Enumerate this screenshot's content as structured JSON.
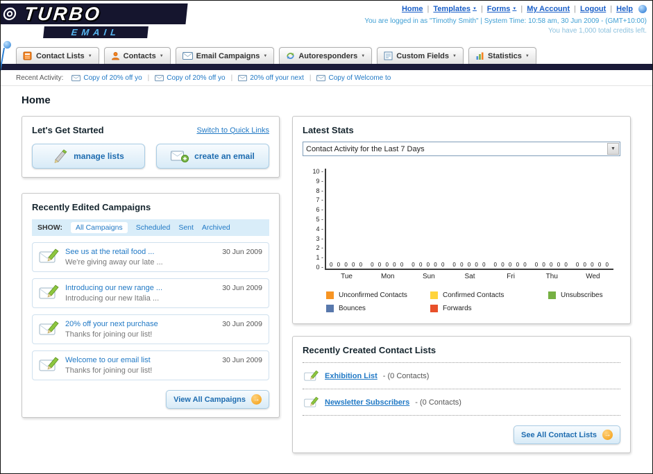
{
  "header": {
    "logo_top": "TURBO",
    "logo_bottom": "EMAIL",
    "nav_links": [
      {
        "label": "Home"
      },
      {
        "label": "Templates"
      },
      {
        "label": "Forms"
      },
      {
        "label": "My Account"
      },
      {
        "label": "Logout"
      },
      {
        "label": "Help"
      }
    ],
    "login_info": "You are logged in as \"Timothy Smith\" | System Time: 10:58 am, 30 Jun 2009 - (GMT+10:00)",
    "credits_info": "You have 1,000 total credits left."
  },
  "nav_tabs": [
    {
      "label": "Contact Lists"
    },
    {
      "label": "Contacts"
    },
    {
      "label": "Email Campaigns"
    },
    {
      "label": "Autoresponders"
    },
    {
      "label": "Custom Fields"
    },
    {
      "label": "Statistics"
    }
  ],
  "recent_activity": {
    "label": "Recent Activity:",
    "items": [
      "Copy of 20% off yo",
      "Copy of 20% off yo",
      "20% off your next",
      "Copy of Welcome to"
    ]
  },
  "page_title": "Home",
  "get_started": {
    "title": "Let's Get Started",
    "switch_link": "Switch to Quick Links",
    "manage_lists_label": "manage lists",
    "create_email_label": "create an email"
  },
  "campaigns": {
    "title": "Recently Edited Campaigns",
    "show_label": "SHOW:",
    "tabs": [
      "All Campaigns",
      "Scheduled",
      "Sent",
      "Archived"
    ],
    "active_tab": "All Campaigns",
    "items": [
      {
        "title": "See us at the retail food ...",
        "subtitle": "We're giving away our late ...",
        "date": "30 Jun 2009"
      },
      {
        "title": "Introducing our new range ...",
        "subtitle": "Introducing our new Italia ...",
        "date": "30 Jun 2009"
      },
      {
        "title": "20% off your next purchase",
        "subtitle": "Thanks for joining our list!",
        "date": "30 Jun 2009"
      },
      {
        "title": "Welcome to our email list",
        "subtitle": "Thanks for joining our list!",
        "date": "30 Jun 2009"
      }
    ],
    "view_all_label": "View All Campaigns"
  },
  "stats": {
    "title": "Latest Stats",
    "selector_value": "Contact Activity for the Last 7 Days",
    "chart_data": {
      "type": "bar",
      "title": "Contact Activity for the Last 7 Days",
      "categories": [
        "Tue",
        "Mon",
        "Sun",
        "Sat",
        "Fri",
        "Thu",
        "Wed"
      ],
      "series": [
        {
          "name": "Unconfirmed Contacts",
          "color": "#f79423",
          "values": [
            0,
            0,
            0,
            0,
            0,
            0,
            0
          ]
        },
        {
          "name": "Confirmed Contacts",
          "color": "#ffd43c",
          "values": [
            0,
            0,
            0,
            0,
            0,
            0,
            0
          ]
        },
        {
          "name": "Unsubscribes",
          "color": "#76b043",
          "values": [
            0,
            0,
            0,
            0,
            0,
            0,
            0
          ]
        },
        {
          "name": "Bounces",
          "color": "#5878ac",
          "values": [
            0,
            0,
            0,
            0,
            0,
            0,
            0
          ]
        },
        {
          "name": "Forwards",
          "color": "#e8502a",
          "values": [
            0,
            0,
            0,
            0,
            0,
            0,
            0
          ]
        }
      ],
      "ylim": [
        0,
        10
      ],
      "ytick_step": 1,
      "grid": false,
      "legend_position": "bottom"
    }
  },
  "contact_lists": {
    "title": "Recently Created Contact Lists",
    "items": [
      {
        "name": "Exhibition List",
        "count": "- (0 Contacts)"
      },
      {
        "name": "Newsletter Subscribers",
        "count": "- (0 Contacts)"
      }
    ],
    "see_all_label": "See All Contact Lists"
  },
  "colors": {
    "brand_dark": "#1a1a38",
    "link_blue": "#2179c5",
    "accent_orange": "#f29a0c"
  }
}
